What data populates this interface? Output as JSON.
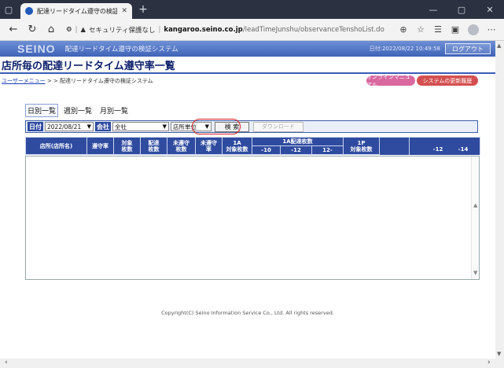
{
  "browser": {
    "tab_title": "配達リードタイム遵守の検証システム",
    "new_tab": "+",
    "address_warning": "セキュリティ保護なし",
    "address_host": "kangaroo.seino.co.jp",
    "address_path": "/leadTimeJunshu/observanceTenshoList.do"
  },
  "header": {
    "logo": "SEINO",
    "system_name": "配達リードタイム遵守の検証システム",
    "date_text": "日付:2022/08/22 10:49:58",
    "logout_label": "ログアウト"
  },
  "page": {
    "title": "店所毎の配達リードタイム遵守率一覧",
    "breadcrumb_link": "ユーザーメニュー",
    "breadcrumb_rest": " > > 配達リードタイム遵守の検証システム",
    "manual_label": "オンラインマニュアル",
    "history_label": "システムの更新履歴"
  },
  "tabs": [
    "日別一覧",
    "週別一覧",
    "月別一覧"
  ],
  "filter": {
    "date_label": "日付",
    "date_value": "2022/08/21",
    "company_label": "会社",
    "company_value": "全社",
    "unit_value": "店所単位",
    "search_label": "検 索",
    "download_label": "ダウンロード"
  },
  "table": {
    "headers": [
      "店所(店所名)",
      "遵守率",
      "対象\n枚数",
      "配達\n枚数",
      "未遵守\n枚数",
      "未遵守\n率",
      "1A\n対象枚数",
      "-10",
      "-12",
      "12-",
      "1P\n対象枚数",
      "-12",
      "-14"
    ],
    "group_header": "1A配達枚数"
  },
  "footer": {
    "copyright": "Copyright(C) Seino Information Service Co., Ltd. All rights reserved."
  }
}
